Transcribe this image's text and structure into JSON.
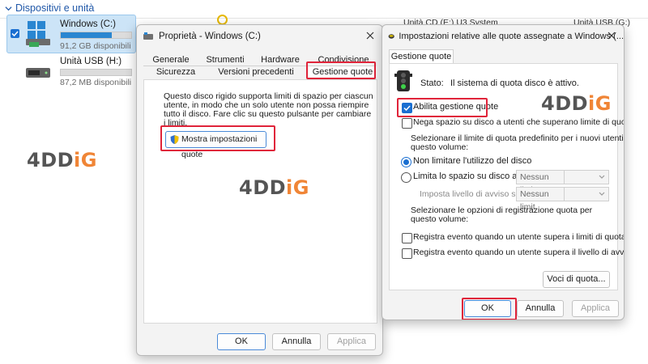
{
  "explorer": {
    "section_title": "Dispositivi e unità",
    "drives": [
      {
        "name": "Windows (C:)",
        "free_text": "91,2 GB disponibili",
        "fill_percent": 72
      },
      {
        "name": "Unità USB (H:)",
        "free_text": "87,2 MB disponibili",
        "fill_percent": 0
      }
    ],
    "bg_right_1": "Unità CD (E:) U3 System",
    "bg_right_2": "Unità USB (G:)"
  },
  "watermark": {
    "part1": "4DD",
    "part2": "iG"
  },
  "properties": {
    "title": "Proprietà - Windows (C:)",
    "tabs_row1": [
      "Generale",
      "Strumenti",
      "Hardware",
      "Condivisione"
    ],
    "tabs_row2": [
      "Sicurezza",
      "Versioni precedenti",
      "Gestione quote"
    ],
    "description": [
      "Questo disco rigido supporta limiti di spazio per ciascun",
      "utente, in modo che un solo utente non possa riempire",
      "tutto il disco. Fare clic su questo pulsante per cambiare",
      "i limiti."
    ],
    "show_quota_button": "Mostra impostazioni quote",
    "ok": "OK",
    "cancel": "Annulla",
    "apply": "Applica"
  },
  "quota": {
    "title": "Impostazioni relative alle quote assegnate a Windows (...",
    "tab": "Gestione quote",
    "status_label": "Stato:",
    "status_text": "Il sistema di quota disco è attivo.",
    "enable_label": "Abilita gestione quote",
    "deny_label": "Nega spazio su disco a utenti che superano limite di quota",
    "select_limit_text": [
      "Selezionare il limite di quota predefinito per i nuovi utenti su",
      "questo volume:"
    ],
    "no_limit_label": "Non limitare l'utilizzo del disco",
    "limit_label": "Limita lo spazio su disco a",
    "limit_value": "Nessun limit",
    "warning_label": "Imposta livello di avviso su",
    "warning_value": "Nessun limit",
    "log_options_text": [
      "Selezionare le opzioni di registrazione quota per",
      "questo volume:"
    ],
    "log_limit_label": "Registra evento quando un utente supera i limiti di quota",
    "log_warning_label": "Registra evento quando un utente supera il livello di avviso",
    "entries_button": "Voci di quota...",
    "ok": "OK",
    "cancel": "Annulla",
    "apply": "Applica"
  }
}
